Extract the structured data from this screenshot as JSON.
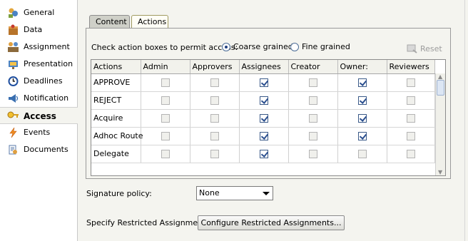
{
  "sidebar": {
    "items": [
      {
        "label": "General",
        "icon": "general-icon"
      },
      {
        "label": "Data",
        "icon": "data-icon"
      },
      {
        "label": "Assignment",
        "icon": "assignment-icon"
      },
      {
        "label": "Presentation",
        "icon": "presentation-icon"
      },
      {
        "label": "Deadlines",
        "icon": "deadlines-icon"
      },
      {
        "label": "Notification",
        "icon": "notification-icon"
      },
      {
        "label": "Access",
        "icon": "access-icon"
      },
      {
        "label": "Events",
        "icon": "events-icon"
      },
      {
        "label": "Documents",
        "icon": "documents-icon"
      }
    ],
    "active": "Access"
  },
  "tabs": [
    {
      "label": "Content"
    },
    {
      "label": "Actions"
    }
  ],
  "selected_tab": "Actions",
  "instruction": "Check action boxes to permit access:",
  "granularity": {
    "coarse_label": "Coarse grained",
    "fine_label": "Fine grained",
    "selected": "Coarse grained"
  },
  "reset_label": "Reset",
  "grid": {
    "columns": [
      "Actions",
      "Admin",
      "Approvers",
      "Assignees",
      "Creator",
      "Owner:",
      "Reviewers"
    ],
    "rows": [
      {
        "action": "APPROVE",
        "checks": [
          false,
          false,
          true,
          false,
          true,
          false
        ]
      },
      {
        "action": "REJECT",
        "checks": [
          false,
          false,
          true,
          false,
          true,
          false
        ]
      },
      {
        "action": "Acquire",
        "checks": [
          false,
          false,
          true,
          false,
          true,
          false
        ]
      },
      {
        "action": "Adhoc Route",
        "checks": [
          false,
          false,
          true,
          false,
          true,
          false
        ]
      },
      {
        "action": "Delegate",
        "checks": [
          false,
          false,
          true,
          false,
          false,
          false
        ]
      }
    ]
  },
  "signature": {
    "label": "Signature policy:",
    "value": "None"
  },
  "restricted": {
    "label": "Specify Restricted Assignment",
    "button": "Configure Restricted Assignments..."
  }
}
